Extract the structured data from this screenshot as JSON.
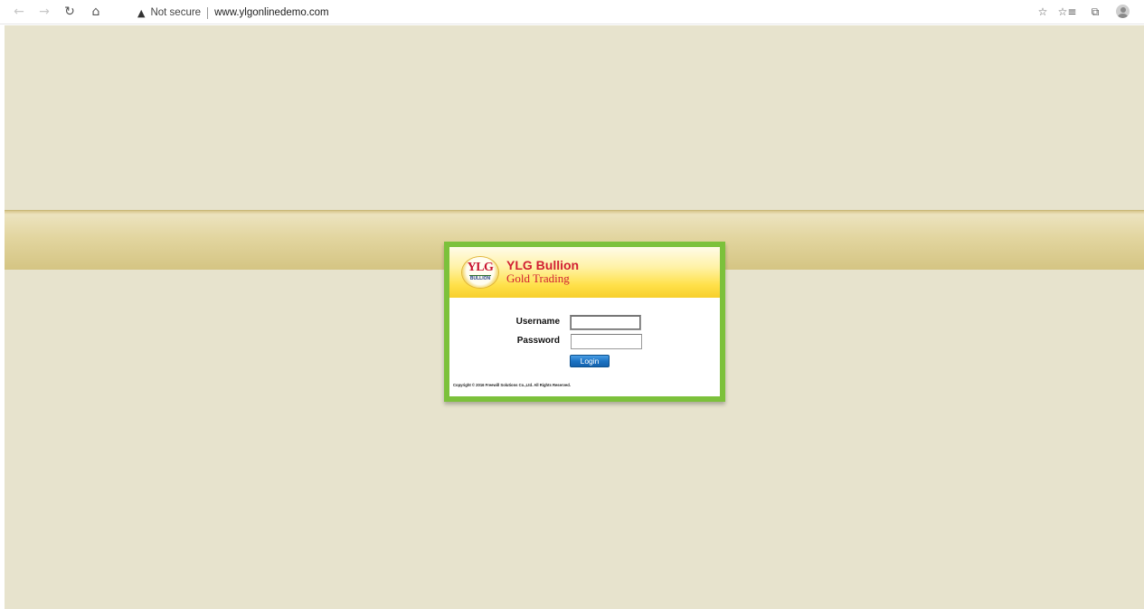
{
  "browser": {
    "security_label": "Not secure",
    "url": "www.ylgonlinedemo.com",
    "icons": {
      "back": "arrow-left-icon",
      "forward": "arrow-right-icon",
      "refresh": "refresh-icon",
      "home": "home-icon",
      "warning": "warning-triangle-icon",
      "favorite": "star-icon",
      "favorites_bar": "favorites-list-icon",
      "collections": "collections-icon",
      "profile": "profile-avatar-icon"
    }
  },
  "login": {
    "brand_title": "YLG Bullion",
    "brand_subtitle": "Gold Trading",
    "logo_text": "YLG",
    "logo_subtext": "BULLION",
    "username_label": "Username",
    "username_value": "",
    "password_label": "Password",
    "password_value": "",
    "login_button": "Login",
    "copyright": "Copyright © 2016 Freewill Solutions Co.,Ltd. All Rights Reserved."
  },
  "colors": {
    "page_background": "#e7e3cd",
    "band": "#e2d59f",
    "box_border": "#7cc13b",
    "header_gold": "#ffe14a",
    "brand_red": "#d11f33",
    "button_blue": "#1c73c4"
  }
}
